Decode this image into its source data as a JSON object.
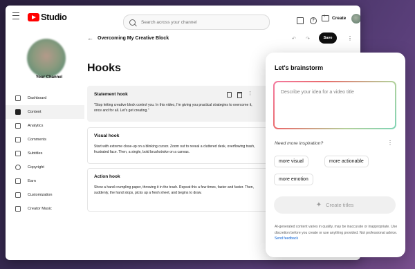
{
  "topbar": {
    "logo_text": "Studio",
    "search_placeholder": "Search across your channel",
    "create_label": "Create"
  },
  "sidebar": {
    "channel_name": "Your Channel",
    "items": [
      {
        "label": "Dashboard",
        "icon": "dashboard-icon"
      },
      {
        "label": "Content",
        "icon": "content-icon",
        "active": true
      },
      {
        "label": "Analytics",
        "icon": "analytics-icon"
      },
      {
        "label": "Comments",
        "icon": "comments-icon"
      },
      {
        "label": "Subtitles",
        "icon": "subtitles-icon"
      },
      {
        "label": "Copyright",
        "icon": "copyright-icon"
      },
      {
        "label": "Earn",
        "icon": "earn-icon"
      },
      {
        "label": "Customization",
        "icon": "customization-icon"
      },
      {
        "label": "Creator Music",
        "icon": "creator-music-icon"
      }
    ]
  },
  "main": {
    "video_title": "Overcoming My Creative Block",
    "save_label": "Save",
    "heading": "Hooks",
    "cards": [
      {
        "title": "Statement hook",
        "body": "\"Stop letting creative block control you.  In this video, I'm giving you practical strategies to overcome it, once and for all.  Let's get creating.\""
      },
      {
        "title": "Visual hook",
        "body": "Start with extreme close-up on a blinking cursor. Zoom out to reveal a cluttered desk, overflowing trash, frustrated face.  Then, a single, bold brushstroke on a canvas."
      },
      {
        "title": "Action hook",
        "body": "Show a hand crumpling paper, throwing it in the trash. Repeat this a few times, faster and faster. Then, suddenly, the hand stops, picks up a fresh sheet, and begins to draw."
      }
    ]
  },
  "panel": {
    "title": "Let's brainstorm",
    "input_placeholder": "Describe your idea for a video title",
    "more_inspiration": "Need more inspiration?",
    "chips": [
      "more visual",
      "more actionable",
      "more emotion"
    ],
    "create_titles_label": "Create titles",
    "disclaimer": "AI-generated content varies in quality, may be inaccurate or inappropriate. Use discretion before you create or use anything provided. Not professional advice.",
    "feedback_link": "Send feedback"
  }
}
